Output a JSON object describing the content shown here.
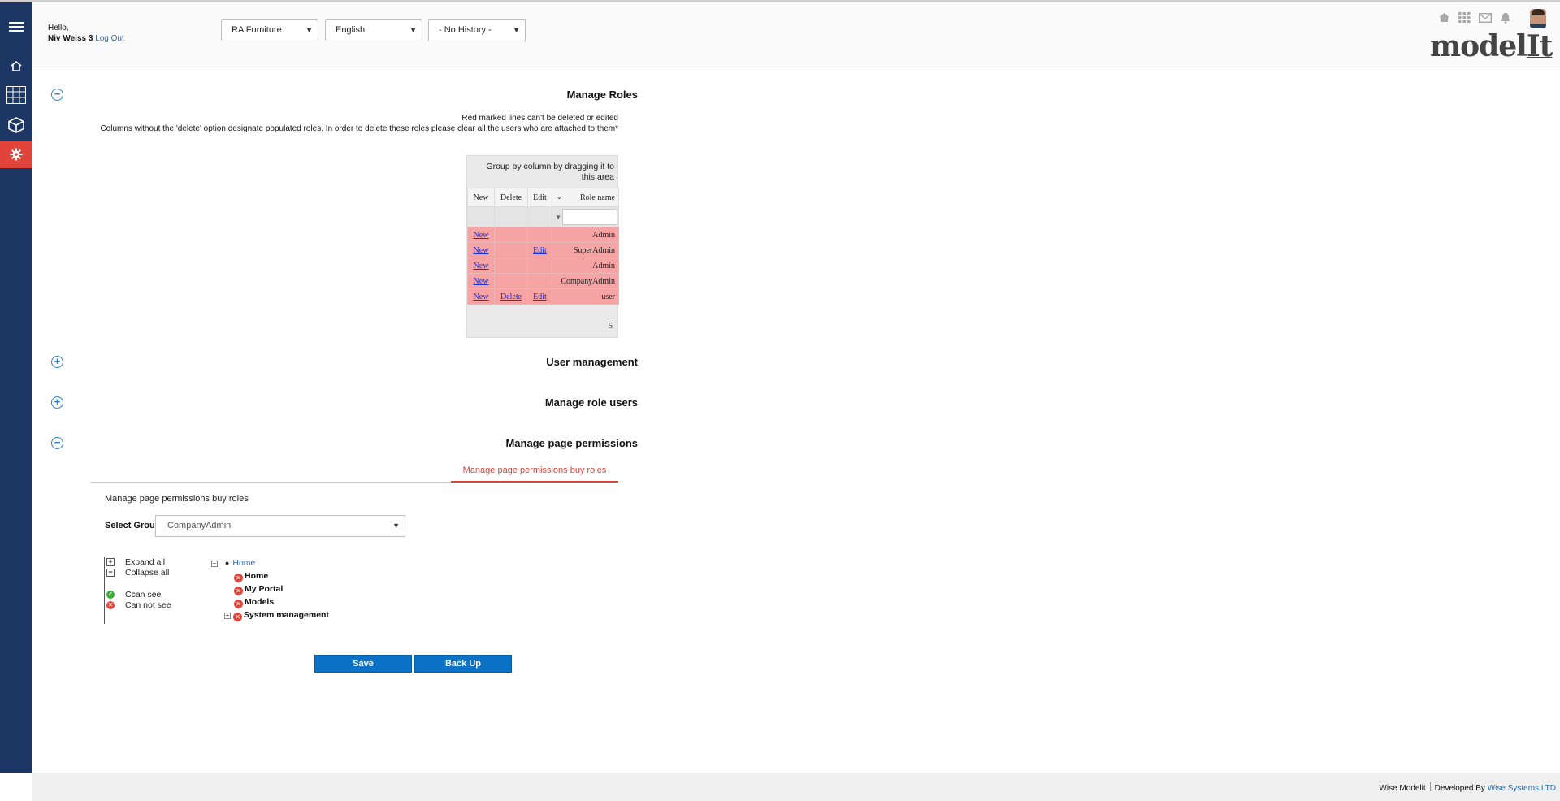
{
  "header": {
    "greeting": "Hello,",
    "user_name": "Niv Weiss 3",
    "logout": "Log Out",
    "company_select": "RA Furniture",
    "language_select": "English",
    "history_select": "- No History -",
    "logo_main": "model",
    "logo_accent": "It"
  },
  "sidebar": {
    "items": [
      "menu-icon",
      "home-icon",
      "grid-icon",
      "cube-icon",
      "settings-icon"
    ],
    "active_color": "#e0443a",
    "bg_color": "#1c3764"
  },
  "manage_roles": {
    "title": "Manage Roles",
    "note1": "Red marked lines can't be deleted or edited",
    "note2": "Columns without the 'delete' option designate populated roles. In order to delete these roles please clear all the users who are attached to them*",
    "group_area": "Group by column by dragging it to this area",
    "columns": [
      "New",
      "Delete",
      "Edit",
      "Role name"
    ],
    "rows": [
      {
        "new": "New",
        "delete": "",
        "edit": "",
        "role": "Admin"
      },
      {
        "new": "New",
        "delete": "",
        "edit": "Edit",
        "role": "SuperAdmin"
      },
      {
        "new": "New",
        "delete": "",
        "edit": "",
        "role": "Admin"
      },
      {
        "new": "New",
        "delete": "",
        "edit": "",
        "role": "CompanyAdmin"
      },
      {
        "new": "New",
        "delete": "Delete",
        "edit": "Edit",
        "role": "user"
      }
    ],
    "count": "5"
  },
  "sections": {
    "user_management": "User management",
    "manage_role_users": "Manage role users",
    "manage_page_permissions": "Manage page permissions"
  },
  "permissions": {
    "tab_label": "Manage page permissions buy roles",
    "subtitle": "Manage page permissions buy roles",
    "select_group_label": "Select Group",
    "select_group_value": "CompanyAdmin",
    "legend": {
      "expand_all": "Expand all",
      "collapse_all": "Collapse all",
      "can_see": "Ccan see",
      "can_not_see": "Can not see"
    },
    "tree": {
      "root": "Home",
      "children": [
        "Home",
        "My Portal",
        "Models",
        "System management"
      ]
    },
    "save_button": "Save",
    "backup_button": "Back Up"
  },
  "footer": {
    "product": "Wise Modelit",
    "developed_by": "Developed By",
    "company": "Wise Systems LTD"
  }
}
